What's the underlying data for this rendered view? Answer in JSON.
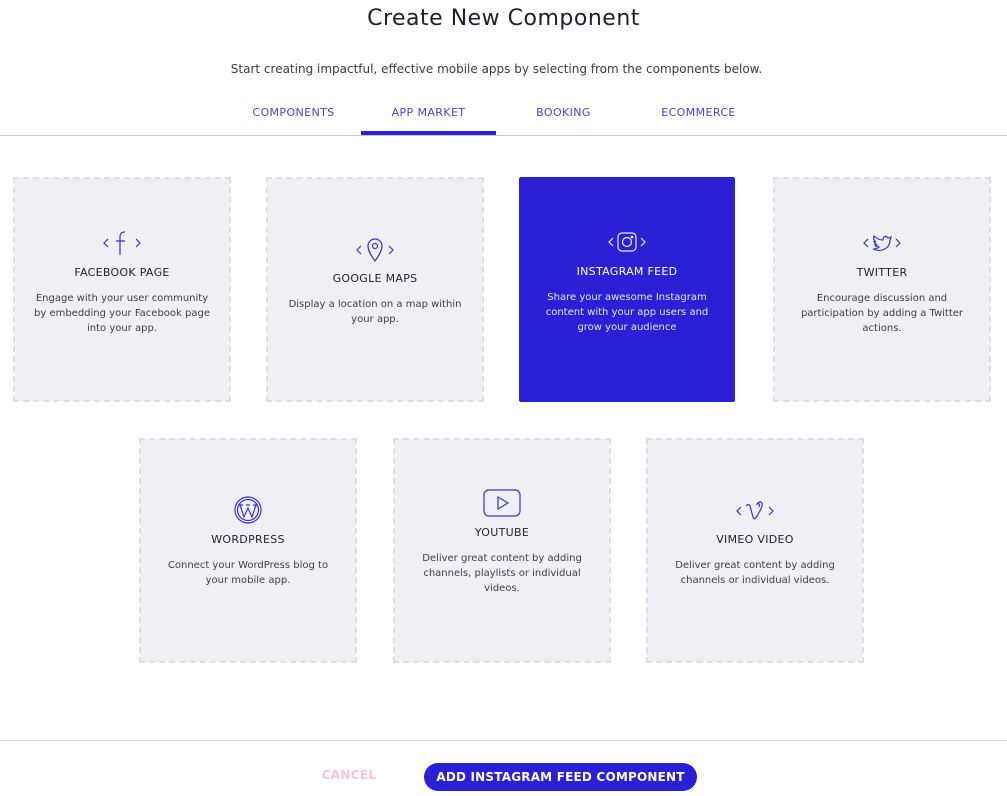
{
  "header": {
    "title": "Create New Component",
    "subtitle": "Start creating impactful, effective mobile apps by selecting from the components below."
  },
  "tabs": [
    {
      "label": "COMPONENTS",
      "active": false
    },
    {
      "label": "APP MARKET",
      "active": true
    },
    {
      "label": "BOOKING",
      "active": false
    },
    {
      "label": "ECOMMERCE",
      "active": false
    }
  ],
  "cards": [
    {
      "id": "facebook",
      "icon": "facebook-icon",
      "title": "FACEBOOK PAGE",
      "desc": "Engage with your user community by embedding your Facebook page into your app.",
      "selected": false
    },
    {
      "id": "google-maps",
      "icon": "map-pin-icon",
      "title": "GOOGLE MAPS",
      "desc": "Display a location on a map within your app.",
      "selected": false
    },
    {
      "id": "instagram",
      "icon": "instagram-icon",
      "title": "INSTAGRAM FEED",
      "desc": "Share your awesome Instagram content with your app users and grow your audience",
      "selected": true
    },
    {
      "id": "twitter",
      "icon": "twitter-icon",
      "title": "TWITTER",
      "desc": "Encourage discussion and participation by adding a Twitter actions.",
      "selected": false
    },
    {
      "id": "wordpress",
      "icon": "wordpress-icon",
      "title": "WORDPRESS",
      "desc": "Connect your WordPress blog to your mobile app.",
      "selected": false
    },
    {
      "id": "youtube",
      "icon": "youtube-icon",
      "title": "YOUTUBE",
      "desc": "Deliver great content by adding channels, playlists or individual videos.",
      "selected": false
    },
    {
      "id": "vimeo",
      "icon": "vimeo-icon",
      "title": "VIMEO VIDEO",
      "desc": "Deliver great content by adding channels or individual videos.",
      "selected": false
    }
  ],
  "footer": {
    "cancel_label": "CANCEL",
    "add_label": "ADD INSTAGRAM FEED COMPONENT"
  },
  "colors": {
    "accent": "#2a20d6",
    "tab_text": "#4b45c8",
    "card_bg": "#f0f0f4",
    "cancel_text": "#f8c4dd"
  }
}
